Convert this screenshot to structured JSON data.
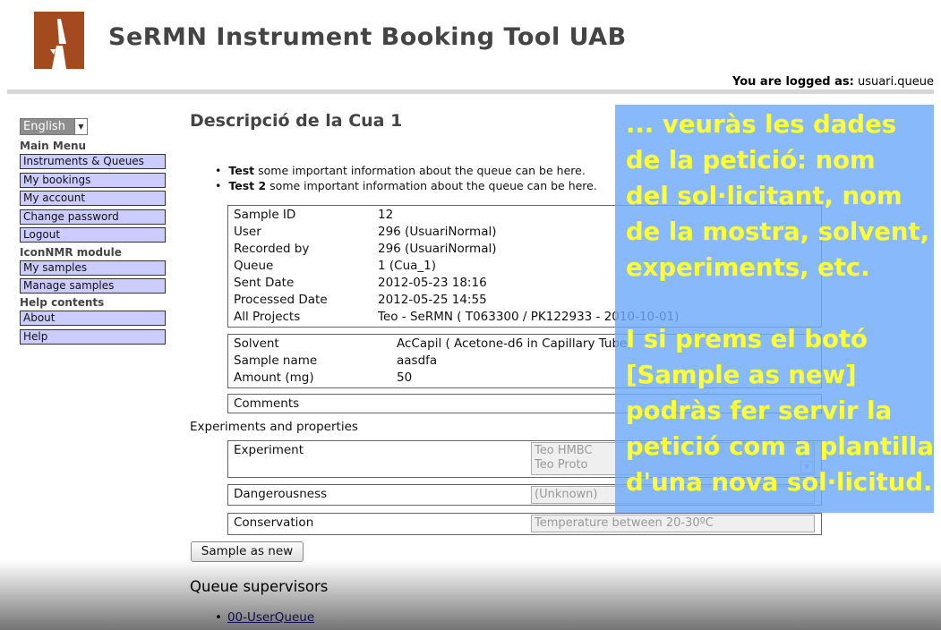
{
  "header": {
    "logo": "sermn-logo",
    "title": "SeRMN Instrument Booking Tool UAB",
    "logged_label": "You are logged as:",
    "logged_user": "usuari.queue"
  },
  "sidebar": {
    "language": "English",
    "main_menu_heading": "Main Menu",
    "main_menu": [
      "Instruments & Queues",
      "My bookings",
      "My account",
      "Change password",
      "Logout"
    ],
    "iconnmr_heading": "IconNMR module",
    "iconnmr_menu": [
      "My samples",
      "Manage samples"
    ],
    "help_heading": "Help contents",
    "help_menu": [
      "About",
      "Help"
    ]
  },
  "main": {
    "page_title": "Descripció de la Cua 1",
    "info": [
      {
        "bold": "Test",
        "text": " some important information about the queue can be here."
      },
      {
        "bold": "Test 2",
        "text": " some important information about the queue can be here."
      }
    ],
    "sample_details": [
      {
        "label": "Sample ID",
        "value": "12"
      },
      {
        "label": "User",
        "value": "296 (UsuariNormal)"
      },
      {
        "label": "Recorded by",
        "value": "296 (UsuariNormal)"
      },
      {
        "label": "Queue",
        "value": "1 (Cua_1)"
      },
      {
        "label": "Sent Date",
        "value": "2012-05-23 18:16"
      },
      {
        "label": "Processed Date",
        "value": "2012-05-25 14:55"
      },
      {
        "label": "All Projects",
        "value": "Teo - SeRMN ( T063300 / PK122933 - 2010-10-01)"
      }
    ],
    "sample_info": [
      {
        "label": "Solvent",
        "value": "AcCapil ( Acetone-d6 in Capillary Tube)"
      },
      {
        "label": "Sample name",
        "value": "aasdfa"
      },
      {
        "label": "Amount (mg)",
        "value": "50"
      }
    ],
    "comments_label": "Comments",
    "experiments_heading": "Experiments and properties",
    "experiment_label": "Experiment",
    "experiment_options": [
      "Teo HMBC",
      "Teo Proto"
    ],
    "dangerousness_label": "Dangerousness",
    "dangerousness_value": "(Unknown)",
    "conservation_label": "Conservation",
    "conservation_value": "Temperature between 20-30ºC",
    "sample_as_new_button": "Sample as new",
    "supervisors_heading": "Queue supervisors",
    "supervisors": [
      "00-UserQueue"
    ]
  },
  "overlay": {
    "lines": [
      "... veuràs les dades",
      "de la petició: nom",
      "del sol·licitant, nom",
      "de la mostra, solvent,",
      "experiments, etc.",
      "",
      "I si prems el botó",
      "[Sample as new]",
      "podràs fer servir la",
      "petició com a plantilla",
      "d'una nova sol·licitud."
    ]
  },
  "colors": {
    "menu_button": "#ccccff",
    "overlay_bg": "#6eaafa",
    "overlay_text": "#ffff33",
    "logo": "#a34a1e"
  }
}
